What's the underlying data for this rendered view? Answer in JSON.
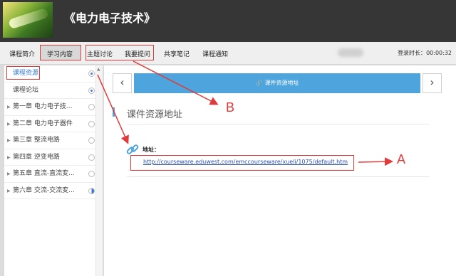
{
  "course": {
    "title": "《电力电子技术》"
  },
  "nav": {
    "items": [
      "课程简介",
      "学习内容",
      "主题讨论",
      "我要提问",
      "共享笔记",
      "课程通知"
    ],
    "timer_label": "登录时长：",
    "timer_value": "00:00:32"
  },
  "sidebar": {
    "items": [
      {
        "label": "课程资源",
        "active": true,
        "status": "filled"
      },
      {
        "label": "课程论坛",
        "active": false,
        "status": "filled"
      },
      {
        "label": "第一章 电力电子技...",
        "active": false,
        "status": "empty"
      },
      {
        "label": "第二章 电力电子器件",
        "active": false,
        "status": "empty"
      },
      {
        "label": "第三章 整流电路",
        "active": false,
        "status": "empty"
      },
      {
        "label": "第四章 逆变电路",
        "active": false,
        "status": "empty"
      },
      {
        "label": "第五章 直流-直流变...",
        "active": false,
        "status": "empty"
      },
      {
        "label": "第六章 交流-交流变...",
        "active": false,
        "status": "half"
      }
    ]
  },
  "main": {
    "pager_title": "课件资源地址",
    "prev_label": "‹",
    "next_label": "›",
    "section_title": "课件资源地址",
    "address_label": "地址：",
    "address_url": "http://courseware.eduwest.com/emccourseware/xueli/1075/default.htm"
  },
  "annotations": {
    "marker_a": "A",
    "marker_b": "B"
  },
  "colors": {
    "header_bg": "#363636",
    "accent": "#4ea4dd",
    "annotation": "#e03a3a",
    "link": "#2a4fb0"
  }
}
